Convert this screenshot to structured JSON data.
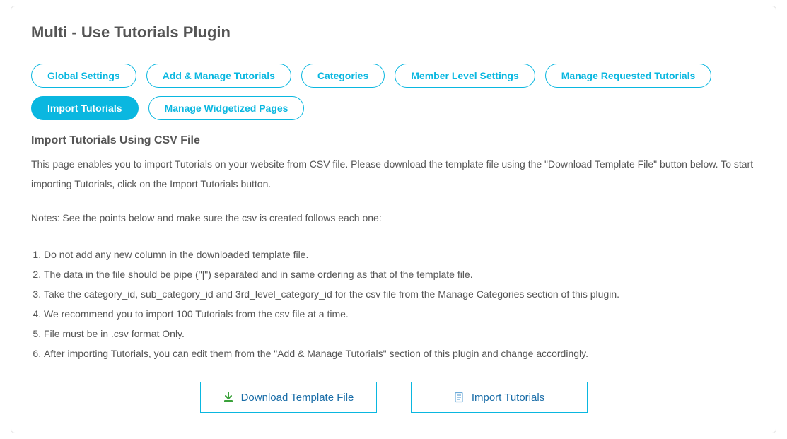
{
  "header": {
    "title": "Multi - Use Tutorials Plugin"
  },
  "tabs": {
    "global_settings": "Global Settings",
    "add_manage": "Add & Manage Tutorials",
    "categories": "Categories",
    "member_level": "Member Level Settings",
    "manage_requested": "Manage Requested Tutorials",
    "import_tutorials": "Import Tutorials",
    "manage_widgetized": "Manage Widgetized Pages"
  },
  "section": {
    "title": "Import Tutorials Using CSV File",
    "description": "This page enables you to import Tutorials on your website from CSV file. Please download the template file using the \"Download Template File\" button below. To start importing Tutorials, click on the Import Tutorials button.",
    "notes_label": "Notes: See the points below and make sure the csv is created follows each one:",
    "notes": [
      "Do not add any new column in the downloaded template file.",
      "The data in the file should be pipe (\"|\") separated and in same ordering as that of the template file.",
      "Take the category_id, sub_category_id and 3rd_level_category_id for the csv file from the Manage Categories section of this plugin.",
      "We recommend you to import 100 Tutorials from the csv file at a time.",
      "File must be in .csv format Only.",
      "After importing Tutorials, you can edit them from the \"Add & Manage Tutorials\" section of this plugin and change accordingly."
    ]
  },
  "actions": {
    "download_template": "Download Template File",
    "import": "Import Tutorials"
  }
}
